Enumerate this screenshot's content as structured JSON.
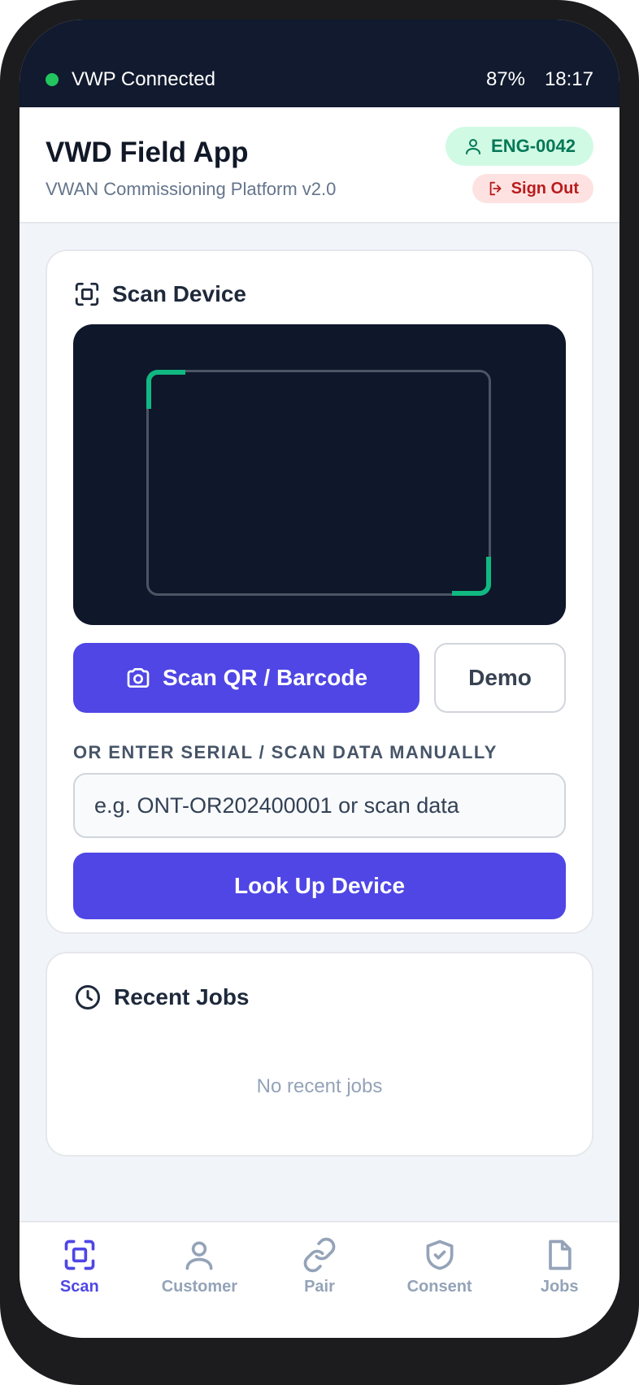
{
  "status_bar": {
    "connection": "VWP Connected",
    "battery": "87%",
    "time": "18:17"
  },
  "header": {
    "title": "VWD Field App",
    "subtitle": "VWAN Commissioning Platform v2.0",
    "user_id": "ENG-0042",
    "sign_out": "Sign Out"
  },
  "scan_card": {
    "title": "Scan Device",
    "scan_button": "Scan QR / Barcode",
    "demo_button": "Demo",
    "manual_label": "OR ENTER SERIAL / SCAN DATA MANUALLY",
    "input_placeholder": "e.g. ONT-OR202400001 or scan data",
    "input_value": "",
    "lookup_button": "Look Up Device"
  },
  "jobs_card": {
    "title": "Recent Jobs",
    "empty_text": "No recent jobs"
  },
  "nav": {
    "items": [
      {
        "label": "Scan",
        "icon": "scan-icon",
        "active": true
      },
      {
        "label": "Customer",
        "icon": "user-icon",
        "active": false
      },
      {
        "label": "Pair",
        "icon": "link-icon",
        "active": false
      },
      {
        "label": "Consent",
        "icon": "shield-check-icon",
        "active": false
      },
      {
        "label": "Jobs",
        "icon": "document-icon",
        "active": false
      }
    ]
  },
  "colors": {
    "primary": "#4f46e5",
    "status_bar_bg": "#111a2e",
    "connected": "#22c55e",
    "scan_corner": "#10b981",
    "user_badge_bg": "#d1fae5",
    "sign_out_bg": "#fee2e2"
  }
}
